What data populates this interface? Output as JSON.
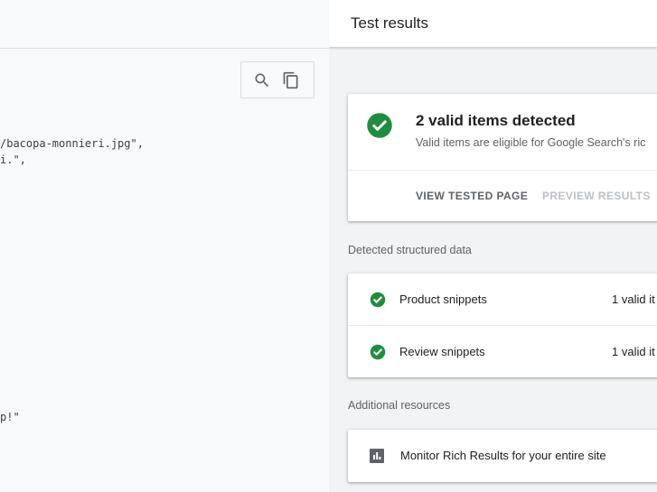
{
  "code_pane": {
    "lines": [
      "/bacopa-monnieri.jpg\",",
      "i.\",",
      "p!\""
    ]
  },
  "results_panel": {
    "title": "Test results",
    "summary": {
      "title": "2 valid items detected",
      "subtitle": "Valid items are eligible for Google Search's ric",
      "actions": {
        "view_tested_page": "VIEW TESTED PAGE",
        "preview_results": "PREVIEW RESULTS"
      }
    },
    "detected_label": "Detected structured data",
    "items": [
      {
        "name": "Product snippets",
        "count": "1 valid it"
      },
      {
        "name": "Review snippets",
        "count": "1 valid it"
      }
    ],
    "additional_label": "Additional resources",
    "resource": {
      "label": "Monitor Rich Results for your entire site"
    }
  },
  "colors": {
    "valid_green": "#1e8e3e",
    "icon_grey": "#5f6368",
    "disabled_text": "#bdc1c6"
  },
  "icons": [
    "search-icon",
    "copy-icon",
    "check-circle-icon",
    "bar-chart-icon"
  ]
}
